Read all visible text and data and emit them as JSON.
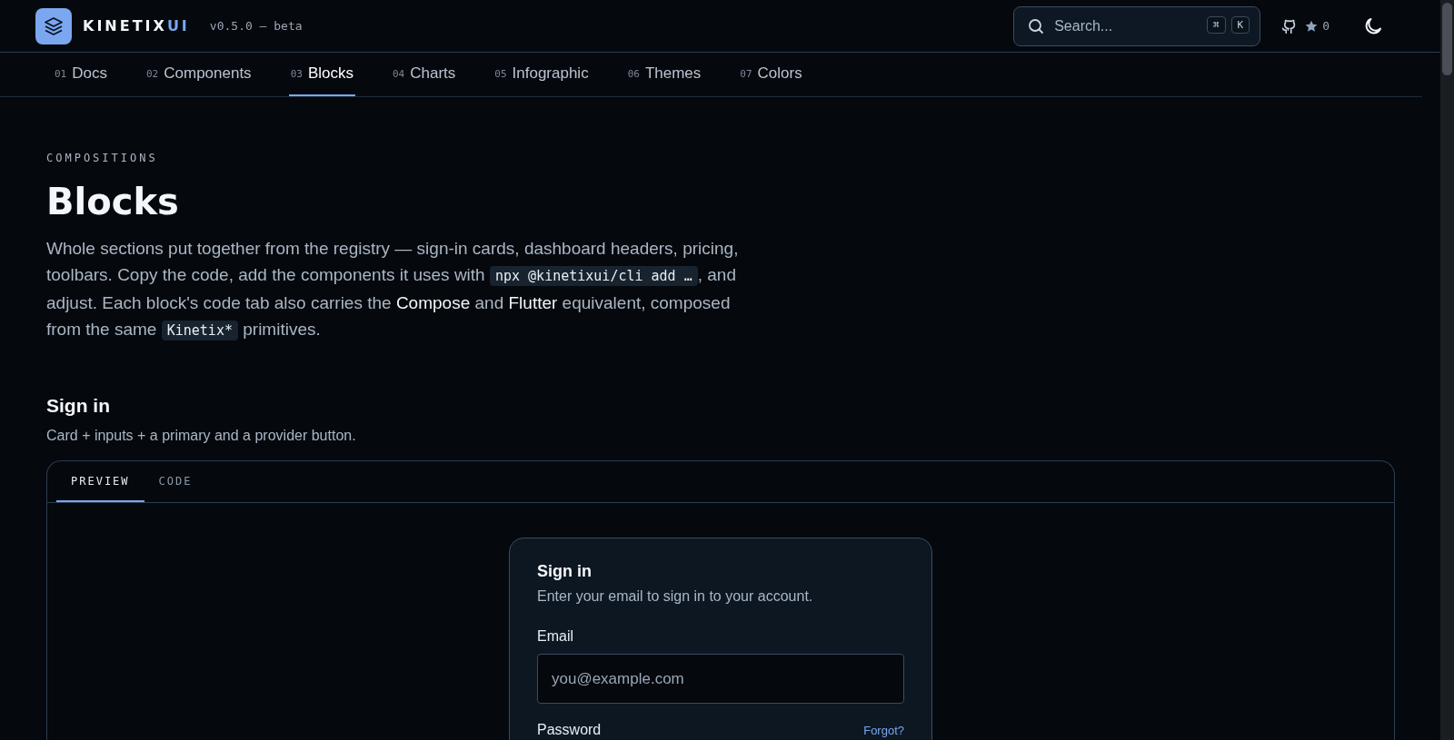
{
  "header": {
    "brand": {
      "name": "KINETIX",
      "accent": "UI"
    },
    "version": "v0.5.0 — beta",
    "search": {
      "placeholder": "Search...",
      "keys": [
        "⌘",
        "K"
      ]
    },
    "stars": "0"
  },
  "nav": [
    {
      "number": "01",
      "label": "Docs",
      "selected": false
    },
    {
      "number": "02",
      "label": "Components",
      "selected": false
    },
    {
      "number": "03",
      "label": "Blocks",
      "selected": true
    },
    {
      "number": "04",
      "label": "Charts",
      "selected": false
    },
    {
      "number": "05",
      "label": "Infographic",
      "selected": false
    },
    {
      "number": "06",
      "label": "Themes",
      "selected": false
    },
    {
      "number": "07",
      "label": "Colors",
      "selected": false
    }
  ],
  "page": {
    "eyebrow": "COMPOSITIONS",
    "title": "Blocks",
    "intro": [
      {
        "kind": "plain",
        "text": "Whole sections put together from the registry — sign-in cards, dashboard headers, pricing, toolbars. Copy the code, add the components it uses with "
      },
      {
        "kind": "code",
        "text": "npx @kinetixui/cli add …"
      },
      {
        "kind": "plain",
        "text": ", and adjust. Each block's code tab also carries the "
      },
      {
        "kind": "strong",
        "text": "Compose"
      },
      {
        "kind": "plain",
        "text": " and "
      },
      {
        "kind": "strong",
        "text": "Flutter"
      },
      {
        "kind": "plain",
        "text": " equivalent, composed from the same "
      },
      {
        "kind": "code",
        "text": "Kinetix*"
      },
      {
        "kind": "plain",
        "text": " primitives."
      }
    ]
  },
  "section": {
    "title": "Sign in",
    "description": "Card + inputs + a primary and a provider button.",
    "tabs": [
      {
        "label": "PREVIEW",
        "selected": true
      },
      {
        "label": "CODE",
        "selected": false
      }
    ],
    "card": {
      "title": "Sign in",
      "subtitle": "Enter your email to sign in to your account.",
      "fields": [
        {
          "label": "Email",
          "placeholder": "you@example.com"
        },
        {
          "label": "Password",
          "link": "Forgot?"
        }
      ]
    }
  }
}
